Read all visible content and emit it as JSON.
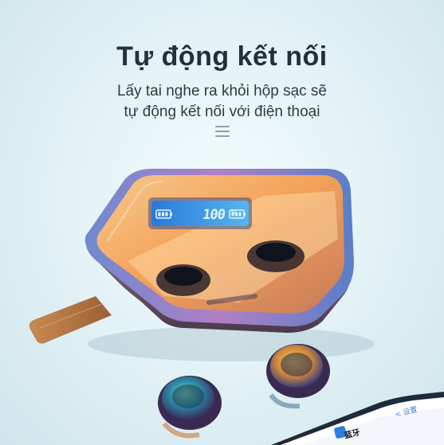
{
  "heading": {
    "title": "Tự động kết nối",
    "line1": "Lấy tai nghe ra khỏi hộp sạc sẽ",
    "line2": "tự động kết nối với điện thoại"
  },
  "case": {
    "display_value": "100",
    "display_unit": "%"
  },
  "phone": {
    "back_label": "< 设置",
    "row_label": "蓝牙"
  },
  "icons": [
    "menu-icon",
    "battery-left-icon",
    "battery-right-icon"
  ],
  "colors": {
    "background": "#e4f3f6",
    "title": "#22303a",
    "lcd": "#2f8de0",
    "case_body": "#7a5a6a",
    "lid_glow": "#f7b56d",
    "strap": "#b97a45"
  }
}
